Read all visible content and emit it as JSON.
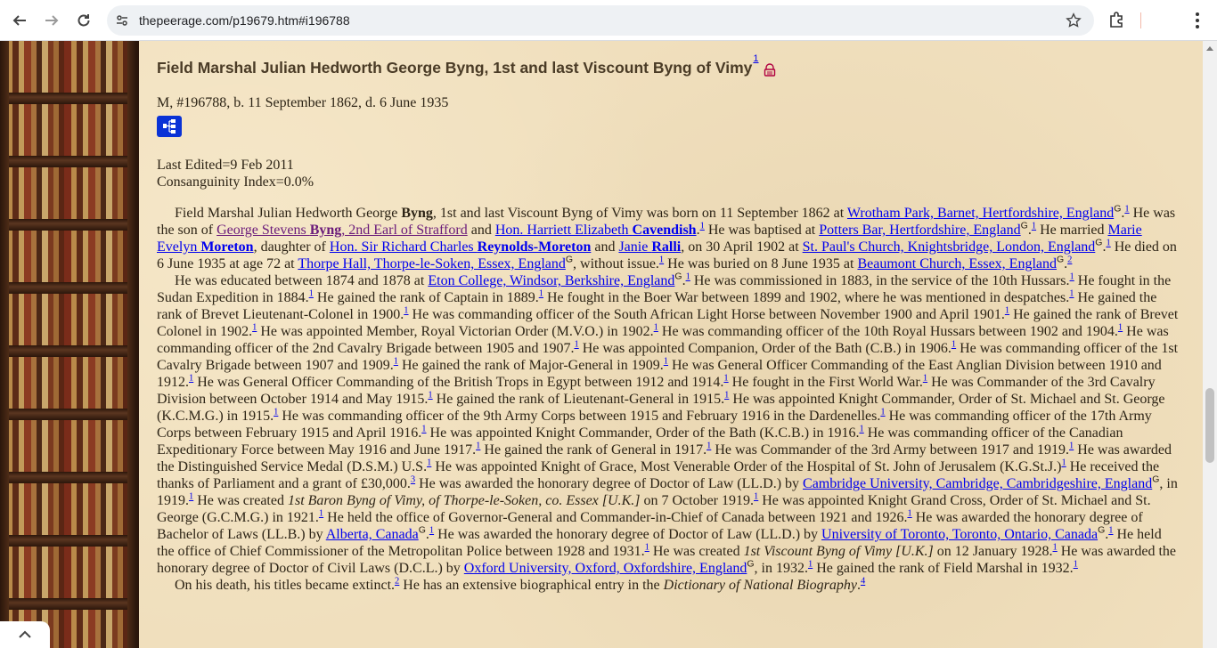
{
  "browser": {
    "url": "thepeerage.com/p19679.htm#i196788"
  },
  "person": {
    "title": "Field Marshal Julian Hedworth George Byng, 1st and last Viscount Byng of Vimy",
    "title_ref": "1",
    "vitals": "M, #196788, b. 11 September 1862, d. 6 June 1935",
    "last_edited": "Last Edited=9 Feb 2011",
    "consanguinity": "Consanguinity Index=0.0%"
  },
  "bio": {
    "intro": "Field Marshal Julian Hedworth George ",
    "surname": "Byng",
    "born_text": ", 1st and last Viscount Byng of Vimy was born on 11 September 1862 at ",
    "birth_place": "Wrotham Park, Barnet, Hertfordshire, England",
    "son_of": " He was the son of ",
    "father_pre": "George Stevens ",
    "father_bold": "Byng",
    "father_post": ", 2nd Earl of Strafford",
    "and": " and ",
    "mother_pre": "Hon. Harriett Elizabeth ",
    "mother_bold": "Cavendish",
    "baptised": " He was baptised at ",
    "baptism_place": "Potters Bar, Hertfordshire, England",
    "married": " He married ",
    "wife_pre": "Marie Evelyn ",
    "wife_bold": "Moreton",
    "daughter_of": ", daughter of ",
    "wfather_pre": "Hon. Sir Richard Charles ",
    "wfather_bold": "Reynolds-Moreton",
    "wmother_pre": "Janie ",
    "wmother_bold": "Ralli",
    "married_on": ", on 30 April 1902 at ",
    "marriage_place": "St. Paul's Church, Knightsbridge, London, England",
    "died": " He died on 6 June 1935 at age 72 at ",
    "death_place": "Thorpe Hall, Thorpe-le-Soken, Essex, England",
    "without_issue": ", without issue.",
    "buried": " He was buried on 8 June 1935 at ",
    "burial_place": "Beaumont Church, Essex, England"
  },
  "career": {
    "educated": "He was educated between 1874 and 1878 at ",
    "school": "Eton College, Windsor, Berkshire, England",
    "p1": " He was commissioned in 1883, in the service of the 10th Hussars.",
    "p2": " He fought in the Sudan Expedition in 1884.",
    "p3": " He gained the rank of Captain in 1889.",
    "p4": " He fought in the Boer War between 1899 and 1902, where he was mentioned in despatches.",
    "p5": " He gained the rank of Brevet Lieutenant-Colonel in 1900.",
    "p6": " He was commanding officer of the South African Light Horse between November 1900 and April 1901.",
    "p7": " He gained the rank of Brevet Colonel in 1902.",
    "p8": " He was appointed Member, Royal Victorian Order (M.V.O.) in 1902.",
    "p9": " He was commanding officer of the 10th Royal Hussars between 1902 and 1904.",
    "p10": " He was commanding officer of the 2nd Cavalry Brigade between 1905 and 1907.",
    "p11": " He was appointed Companion, Order of the Bath (C.B.) in 1906.",
    "p12": " He was commanding officer of the 1st Cavalry Brigade between 1907 and 1909.",
    "p13": " He gained the rank of Major-General in 1909.",
    "p14": " He was General Officer Commanding of the East Anglian Division between 1910 and 1912.",
    "p15": " He was General Officer Commanding of the British Trops in Egypt between 1912 and 1914.",
    "p16": " He fought in the First World War.",
    "p17": " He was Commander of the 3rd Cavalry Division between October 1914 and May 1915.",
    "p18": " He gained the rank of Lieutenant-General in 1915.",
    "p19": " He was appointed Knight Commander, Order of St. Michael and St. George (K.C.M.G.) in 1915.",
    "p20": " He was commanding officer of the 9th Army Corps between 1915 and February 1916 in the Dardenelles.",
    "p21": " He was commanding officer of the 17th Army Corps between February 1915 and April 1916.",
    "p22": " He was appointed Knight Commander, Order of the Bath (K.C.B.) in 1916.",
    "p23": " He was commanding officer of the Canadian Expeditionary Force between May 1916 and June 1917.",
    "p24": " He gained the rank of General in 1917.",
    "p25": " He was Commander of the 3rd Army between 1917 and 1919.",
    "p26": " He was awarded the Distinguished Service Medal (D.S.M.) U.S.",
    "p27": " He was appointed Knight of Grace, Most Venerable Order of the Hospital of St. John of Jerusalem (K.G.St.J.)",
    "p28": " He received the thanks of Parliament and a grant of £30,000.",
    "p29": " He was awarded the honorary degree of Doctor of Law (LL.D.) by ",
    "cambridge": "Cambridge University, Cambridge, Cambridgeshire, England",
    "p30": ", in 1919.",
    "p31a": " He was created ",
    "p31i": "1st Baron Byng of Vimy, of Thorpe-le-Soken, co. Essex [U.K.]",
    "p31b": " on 7 October 1919.",
    "p32": " He was appointed Knight Grand Cross, Order of St. Michael and St. George (G.C.M.G.) in 1921.",
    "p33": " He held the office of Governor-General and Commander-in-Chief of Canada between 1921 and 1926.",
    "p34": " He was awarded the honorary degree of Bachelor of Laws (LL.B.) by ",
    "alberta": "Alberta, Canada",
    "p35": " He was awarded the honorary degree of Doctor of Law (LL.D.) by ",
    "toronto": "University of Toronto, Toronto, Ontario, Canada",
    "p36": " He held the office of Chief Commissioner of the Metropolitan Police between 1928 and 1931.",
    "p37a": " He was created ",
    "p37i": "1st Viscount Byng of Vimy [U.K.]",
    "p37b": " on 12 January 1928.",
    "p38": " He was awarded the honorary degree of Doctor of Civil Laws (D.C.L.) by ",
    "oxford": "Oxford University, Oxford, Oxfordshire, England",
    "p39": ", in 1932.",
    "p40": " He gained the rank of Field Marshal in 1932."
  },
  "death": {
    "extinct": "On his death, his titles became extinct.",
    "entry": " He has an extensive biographical entry in the ",
    "dnb": "Dictionary of National Biography",
    "dot": "."
  },
  "refs": {
    "r1": "1",
    "r2": "2",
    "r3": "3",
    "r4": "4",
    "g": "G",
    "period": "."
  }
}
